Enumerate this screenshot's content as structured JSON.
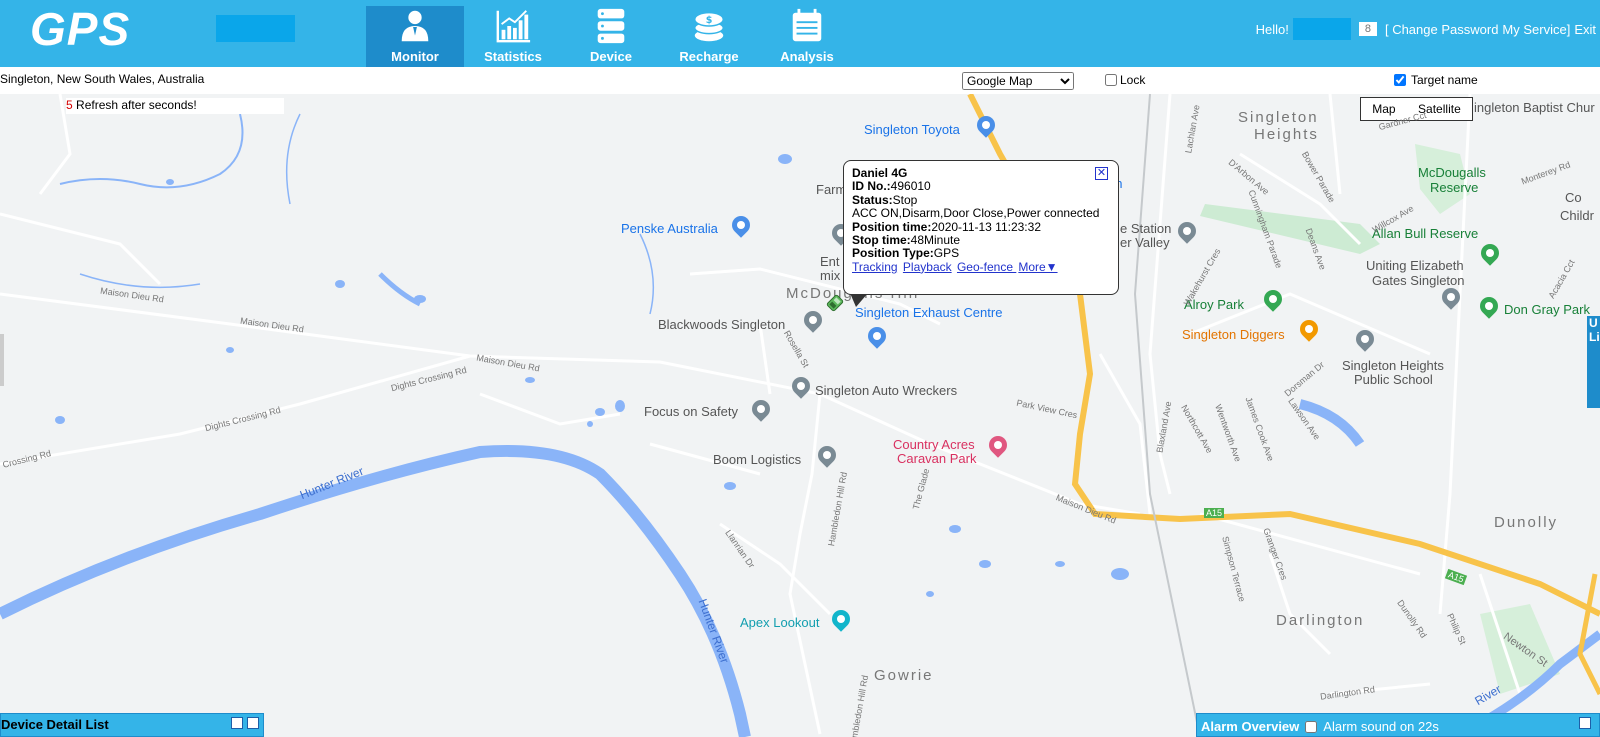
{
  "header": {
    "logo": "GPS",
    "nav": [
      {
        "label": "Monitor",
        "icon": "user-icon",
        "active": true
      },
      {
        "label": "Statistics",
        "icon": "bar-chart-icon",
        "active": false
      },
      {
        "label": "Device",
        "icon": "server-icon",
        "active": false
      },
      {
        "label": "Recharge",
        "icon": "coins-icon",
        "active": false
      },
      {
        "label": "Analysis",
        "icon": "calendar-icon",
        "active": false
      }
    ],
    "hello": "Hello!",
    "count": "8",
    "change_password": "[ Change Password",
    "my_service": "My Service]",
    "exit": "Exit"
  },
  "toolbar": {
    "address": "Singleton, New South Wales, Australia",
    "map_provider": "Google Map",
    "lock_label": "Lock",
    "lock_checked": false,
    "target_name_label": "Target name",
    "target_name_checked": true
  },
  "map": {
    "refresh_seconds": "5",
    "refresh_text": "Refresh after seconds!",
    "map_type_map": "Map",
    "map_type_satellite": "Satellite",
    "places": {
      "singleton_toyota": "Singleton Toyota",
      "penske": "Penske Australia",
      "farm": "Farm",
      "entmix_1": "Ent",
      "entmix_2": "mix",
      "station_1": "e Station",
      "station_2": "er Valley",
      "mcdougalls_hill": "McDougalls Hill",
      "blackwoods": "Blackwoods Singleton",
      "exhaust": "Singleton Exhaust Centre",
      "auto_wreckers": "Singleton Auto Wreckers",
      "focus_safety": "Focus on Safety",
      "boom": "Boom Logistics",
      "country_acres_1": "Country Acres",
      "country_acres_2": "Caravan Park",
      "apex": "Apex Lookout",
      "gowrie": "Gowrie",
      "singleton_heights_1": "Singleton",
      "singleton_heights_2": "Heights",
      "mcdougalls_reserve_1": "McDougalls",
      "mcdougalls_reserve_2": "Reserve",
      "allan_bull": "Allan Bull Reserve",
      "uniting_1": "Uniting Elizabeth",
      "uniting_2": "Gates Singleton",
      "alroy_park": "Alroy Park",
      "don_gray": "Don Gray Park",
      "diggers": "Singleton Diggers",
      "heights_school_1": "Singleton Heights",
      "heights_school_2": "Public School",
      "baptist": "ingleton Baptist Chur",
      "co": "Co",
      "childr": "Childr",
      "dunolly": "Dunolly",
      "darlington": "Darlington",
      "on": "on"
    },
    "streets": {
      "maison_dieu_rd_1": "Maison Dieu Rd",
      "maison_dieu_rd_2": "Maison Dieu Rd",
      "maison_dieu_rd_3": "Maison Dieu Rd",
      "maison_dieu_rd_4": "Maison Dieu Rd",
      "dights_crossing_1": "Dights Crossing Rd",
      "dights_crossing_2": "Dights Crossing Rd",
      "crossing_rd": "Crossing Rd",
      "hambledon_hill": "Hambledon Hill Rd",
      "hambledon_hill_2": "ambledon Hill Rd",
      "llanrian": "Llanrian Dr",
      "the_glade": "The Glade",
      "park_view": "Park View Cres",
      "rosella": "Rosella St",
      "a15_1": "A15",
      "a15_2": "A15",
      "newton_st": "Newton St",
      "darlington_rd": "Darlington Rd",
      "dunolly_rd": "Dunolly Rd",
      "philip_st": "Philip St",
      "simpson_terrace": "Simpson Terrace",
      "blaxland": "Blaxland Ave",
      "northcott": "Northcott Ave",
      "wentworth": "Wentworth Ave",
      "james_cook": "James Cook Ave",
      "lawson": "Lawson Ave",
      "dorsman": "Dorsman Dr",
      "wakehurst": "Wakehurst Cres",
      "deans": "Deans Ave",
      "cunningham": "Cunningham Parade",
      "bower": "Bower Parade",
      "darbon": "D'Arbon Ave",
      "lachlan": "Lachlan Ave",
      "willcox": "Willcox Ave",
      "monterey": "Monterey Rd",
      "acacia": "Acacia Cct",
      "granger": "Granger Cres",
      "gardner": "Gardner Cct"
    },
    "rivers": {
      "hunter_1": "Hunter River",
      "hunter_2": "Hunter River",
      "river_3": "River"
    }
  },
  "popup": {
    "name": "Daniel 4G",
    "id_label": "ID No.:",
    "id_value": "496010",
    "status_label": "Status:",
    "status_value": "Stop",
    "details": "ACC ON,Disarm,Door Close,Power connected",
    "position_time_label": "Position time:",
    "position_time_value": "2020-11-13 11:23:32",
    "stop_time_label": "Stop time:",
    "stop_time_value": "48Minute",
    "position_type_label": "Position Type:",
    "position_type_value": "GPS",
    "links": {
      "tracking": "Tracking",
      "playback": "Playback",
      "geofence": " Geo-fence ",
      "more": "More▼"
    }
  },
  "panels": {
    "device_list_title": "Device Detail List",
    "alarm_title": "Alarm Overview",
    "alarm_sound_label": "Alarm sound on 22s",
    "alarm_sound_checked": false,
    "right_tab_1": "U",
    "right_tab_2": "Li"
  },
  "colors": {
    "header_bg": "#34b4e8",
    "nav_active": "#1e8ccb",
    "water": "#8ab4f8",
    "highway": "#fbc04d",
    "map_bg": "#f1f3f4"
  }
}
